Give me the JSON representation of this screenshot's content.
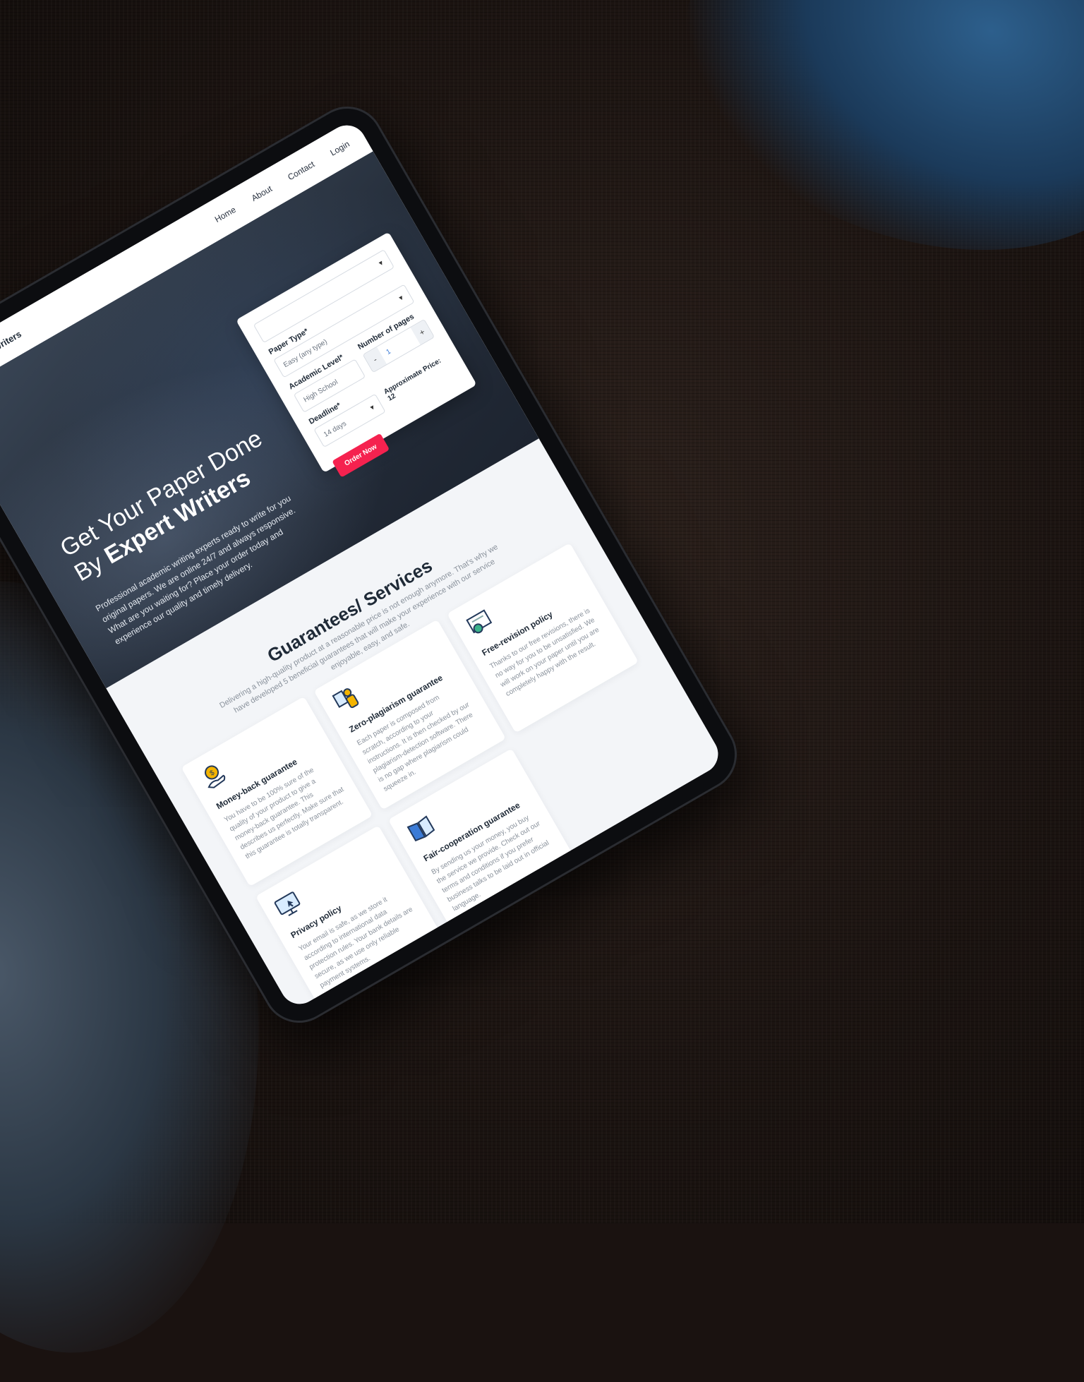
{
  "header": {
    "logo_text": "Expert Writers",
    "nav": [
      "Home",
      "About",
      "Contact",
      "Login"
    ]
  },
  "hero": {
    "title_line1": "Get Your Paper Done",
    "title_by": "By ",
    "title_bold": "Expert Writers",
    "description": "Professional academic writing experts ready to write for you original papers. We are online 24/7 and always responsive. What are you waiting for? Place your order today and experience our quality and timely delivery."
  },
  "order_form": {
    "top_select_value": "",
    "paper_type_label": "Paper Type*",
    "paper_type_value": "Easy (any type)",
    "academic_level_label": "Academic Level*",
    "academic_level_value": "High School",
    "deadline_label": "Deadline*",
    "deadline_value": "14 days",
    "pages_label": "Number of pages",
    "pages_value": "1",
    "decrement": "-",
    "increment": "+",
    "order_button": "Order Now",
    "approx_price": "Approximate Price: 12"
  },
  "services": {
    "title": "Guarantees/ Services",
    "description": "Delivering a high-quality product at a reasonable price is not enough anymore. That's why we have developed 5 beneficial guarantees that will make your experience with our service enjoyable, easy, and safe.",
    "cards": [
      {
        "icon": "money-hand-icon",
        "title": "Money-back guarantee",
        "text": "You have to be 100% sure of the quality of your product to give a money-back guarantee. This describes us perfectly. Make sure that this guarantee is totally transparent."
      },
      {
        "icon": "plagiarism-icon",
        "title": "Zero-plagiarism guarantee",
        "text": "Each paper is composed from scratch, according to your instructions. It is then checked by our plagiarism-detection software. There is no gap where plagiarism could squeeze in."
      },
      {
        "icon": "certificate-icon",
        "title": "Free-revision policy",
        "text": "Thanks to our free revisions, there is no way for you to be unsatisfied. We will work on your paper until you are completely happy with the result."
      },
      {
        "icon": "privacy-monitor-icon",
        "title": "Privacy policy",
        "text": "Your email is safe, as we store it according to international data protection rules. Your bank details are secure, as we use only reliable payment systems."
      },
      {
        "icon": "book-icon",
        "title": "Fair-cooperation guarantee",
        "text": "By sending us your money, you buy the service we provide. Check out our terms and conditions if you prefer business talks to be laid out in official language."
      }
    ]
  },
  "colors": {
    "accent": "#f5224f",
    "hero_dark": "#27303d",
    "page_bg": "#f3f5f8"
  }
}
